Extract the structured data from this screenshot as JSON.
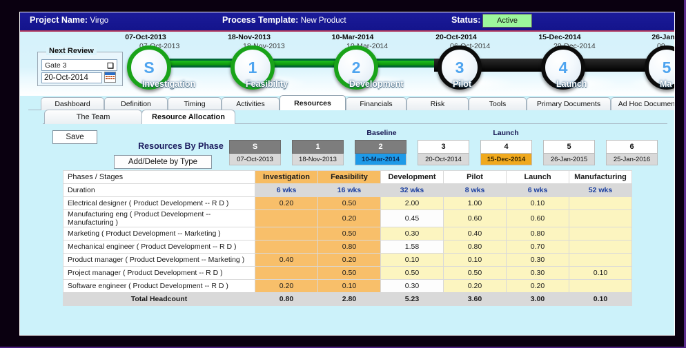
{
  "titlebar": {
    "project_label": "Project Name:",
    "project_value": "Virgo",
    "template_label": "Process Template:",
    "template_value": "New Product",
    "status_label": "Status:",
    "status_value": "Active",
    "status_color": "#9cf79c"
  },
  "next_review": {
    "legend": "Next Review",
    "gate_value": "Gate 3",
    "date_value": "20-Oct-2014",
    "chevron": "✖"
  },
  "timeline": {
    "gates": [
      {
        "id": "S",
        "date_top": "07-Oct-2013",
        "date_bottom": "07-Oct-2013",
        "phase": "Investigation",
        "style": "green"
      },
      {
        "id": "1",
        "date_top": "18-Nov-2013",
        "date_bottom": "18-Nov-2013",
        "phase": "Feasibility",
        "style": "green"
      },
      {
        "id": "2",
        "date_top": "10-Mar-2014",
        "date_bottom": "10-Mar-2014",
        "phase": "Development",
        "style": "green"
      },
      {
        "id": "3",
        "date_top": "20-Oct-2014",
        "date_bottom": "06-Oct-2014",
        "phase": "Pilot",
        "style": "dark"
      },
      {
        "id": "4",
        "date_top": "15-Dec-2014",
        "date_bottom": "29-Dec-2014",
        "phase": "Launch",
        "style": "dark"
      },
      {
        "id": "5",
        "date_top": "26-Jan",
        "date_bottom": "09-",
        "phase": "Ma",
        "style": "dark"
      }
    ]
  },
  "tabs": [
    {
      "label": "Dashboard",
      "active": false
    },
    {
      "label": "Definition",
      "active": false
    },
    {
      "label": "Timing",
      "active": false
    },
    {
      "label": "Activities",
      "active": false
    },
    {
      "label": "Resources",
      "active": true
    },
    {
      "label": "Financials",
      "active": false
    },
    {
      "label": "Risk",
      "active": false
    },
    {
      "label": "Tools",
      "active": false
    },
    {
      "label": "Primary Documents",
      "active": false
    },
    {
      "label": "Ad Hoc Documents",
      "active": false
    }
  ],
  "subtabs": [
    {
      "label": "The Team",
      "active": false
    },
    {
      "label": "Resource Allocation",
      "active": true
    }
  ],
  "toolbar": {
    "save_label": "Save",
    "section_title": "Resources By Phase",
    "add_delete_label": "Add/Delete by Type"
  },
  "gate_strip": {
    "baseline_caption": "Baseline",
    "launch_caption": "Launch",
    "cells": [
      {
        "num": "S",
        "date": "07-Oct-2013",
        "num_style": "grey",
        "date_style": "plain"
      },
      {
        "num": "1",
        "date": "18-Nov-2013",
        "num_style": "grey",
        "date_style": "plain"
      },
      {
        "num": "2",
        "date": "10-Mar-2014",
        "num_style": "grey",
        "date_style": "blue"
      },
      {
        "num": "3",
        "date": "20-Oct-2014",
        "num_style": "white",
        "date_style": "plain"
      },
      {
        "num": "4",
        "date": "15-Dec-2014",
        "num_style": "white",
        "date_style": "orange"
      },
      {
        "num": "5",
        "date": "26-Jan-2015",
        "num_style": "white",
        "date_style": "plain"
      },
      {
        "num": "6",
        "date": "25-Jan-2016",
        "num_style": "white",
        "date_style": "plain"
      }
    ]
  },
  "table": {
    "row_header_label": "Phases / Stages",
    "duration_label": "Duration",
    "total_label": "Total Headcount",
    "columns": [
      "Investigation",
      "Feasibility",
      "Development",
      "Pilot",
      "Launch",
      "Manufacturing"
    ],
    "durations": [
      "6 wks",
      "16 wks",
      "32 wks",
      "8 wks",
      "6 wks",
      "52 wks"
    ],
    "rows": [
      {
        "name": "Electrical designer ( Product Development -- R D )",
        "values": [
          "0.20",
          "0.50",
          "2.00",
          "1.00",
          "0.10",
          ""
        ]
      },
      {
        "name": "Manufacturing eng ( Product Development -- Manufacturing )",
        "values": [
          "",
          "0.20",
          "0.45",
          "0.60",
          "0.60",
          ""
        ]
      },
      {
        "name": "Marketing ( Product Development -- Marketing )",
        "values": [
          "",
          "0.50",
          "0.30",
          "0.40",
          "0.80",
          ""
        ]
      },
      {
        "name": "Mechanical engineer ( Product Development -- R D )",
        "values": [
          "",
          "0.80",
          "1.58",
          "0.80",
          "0.70",
          ""
        ]
      },
      {
        "name": "Product manager ( Product Development -- Marketing )",
        "values": [
          "0.40",
          "0.20",
          "0.10",
          "0.10",
          "0.30",
          ""
        ]
      },
      {
        "name": "Project manager ( Product Development -- R D )",
        "values": [
          "",
          "0.50",
          "0.50",
          "0.50",
          "0.30",
          "0.10"
        ]
      },
      {
        "name": "Software engineer ( Product Development -- R D )",
        "values": [
          "0.20",
          "0.10",
          "0.30",
          "0.20",
          "0.20",
          ""
        ]
      }
    ],
    "totals": [
      "0.80",
      "2.80",
      "5.23",
      "3.60",
      "3.00",
      "0.10"
    ]
  }
}
